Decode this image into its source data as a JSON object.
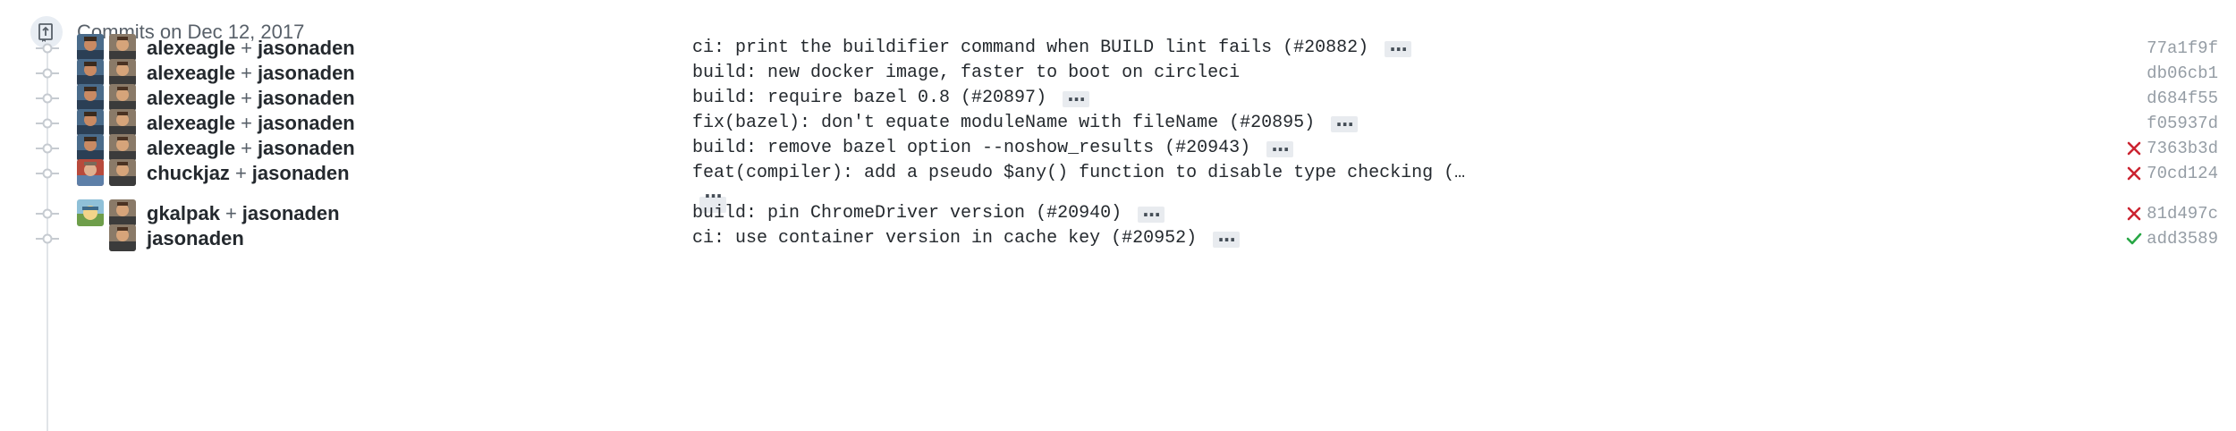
{
  "group": {
    "title": "Commits on Dec 12, 2017",
    "icon": "commit-group-icon"
  },
  "plus_sign": "+",
  "colors": {
    "fail": "#cb2431",
    "success": "#28a745"
  },
  "commits": [
    {
      "authors": [
        "alexeagle",
        "jasonaden"
      ],
      "message": "ci: print the buildifier command when BUILD lint fails (#20882)",
      "sha": "77a1f9f",
      "status": "none",
      "has_ellipsis": true
    },
    {
      "authors": [
        "alexeagle",
        "jasonaden"
      ],
      "message": "build: new docker image, faster to boot on circleci",
      "sha": "db06cb1",
      "status": "none",
      "has_ellipsis": false
    },
    {
      "authors": [
        "alexeagle",
        "jasonaden"
      ],
      "message": "build: require bazel 0.8 (#20897)",
      "sha": "d684f55",
      "status": "none",
      "has_ellipsis": true
    },
    {
      "authors": [
        "alexeagle",
        "jasonaden"
      ],
      "message": "fix(bazel): don't equate moduleName with fileName (#20895)",
      "sha": "f05937d",
      "status": "none",
      "has_ellipsis": true
    },
    {
      "authors": [
        "alexeagle",
        "jasonaden"
      ],
      "message": "build: remove bazel option --noshow_results (#20943)",
      "sha": "7363b3d",
      "status": "failure",
      "has_ellipsis": true
    },
    {
      "authors": [
        "chuckjaz",
        "jasonaden"
      ],
      "message": "feat(compiler): add a pseudo $any() function to disable type checking (…",
      "sha": "70cd124",
      "status": "failure",
      "has_ellipsis": true
    },
    {
      "authors": [
        "gkalpak",
        "jasonaden"
      ],
      "message": "build: pin ChromeDriver version (#20940)",
      "sha": "81d497c",
      "status": "failure",
      "has_ellipsis": true
    },
    {
      "authors": [
        "jasonaden"
      ],
      "message": "ci: use container version in cache key (#20952)",
      "sha": "add3589",
      "status": "success",
      "has_ellipsis": true
    }
  ]
}
